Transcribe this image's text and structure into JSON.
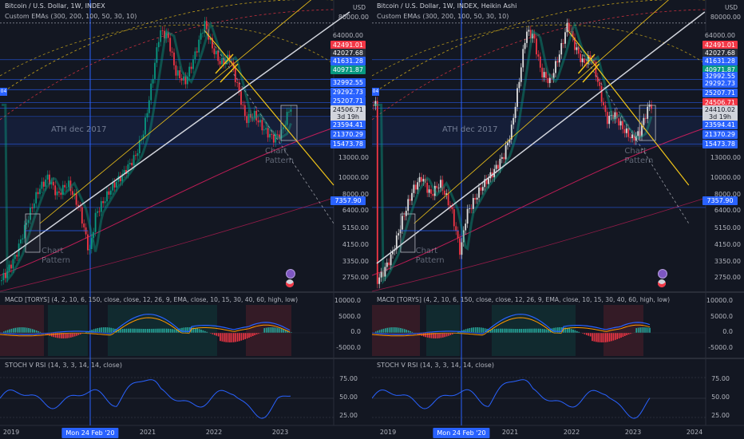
{
  "window": {
    "width": 932,
    "height": 550
  },
  "currency": "USD",
  "panels": [
    {
      "id": "left",
      "title": "Bitcoin / U.S. Dollar, 1W, INDEX",
      "indicator": "Custom EMAs (300, 200, 100, 50, 30, 10)",
      "macd_label": "MACD [TORYS] (4, 2, 10, 6, 150, close, close, 12, 26, 9, EMA, close, 10, 15, 30, 40, 60, high, low)",
      "stoch_label": "STOCH V RSI (14, 3, 3, 14, 14, close)",
      "price_ticks": [
        "80000.00",
        "13000.00",
        "10000.00",
        "8000.00",
        "6400.00",
        "5150.00",
        "4150.00",
        "3350.00",
        "2750.00"
      ],
      "price_tags": [
        {
          "value": "64000.00",
          "bg": "#131722",
          "fg": "#b2b5be"
        },
        {
          "value": "42491.01",
          "bg": "#f23645",
          "fg": "#ffffff"
        },
        {
          "value": "42027.68",
          "bg": "#2a2e39",
          "fg": "#ffffff"
        },
        {
          "value": "41631.28",
          "bg": "#2962ff",
          "fg": "#ffffff"
        },
        {
          "value": "40971.87",
          "bg": "#089981",
          "fg": "#ffffff"
        },
        {
          "value": "32992.55",
          "bg": "#2962ff",
          "fg": "#ffffff"
        },
        {
          "value": "29292.73",
          "bg": "#2962ff",
          "fg": "#ffffff"
        },
        {
          "value": "25207.71",
          "bg": "#2962ff",
          "fg": "#ffffff"
        },
        {
          "value": "24506.71",
          "bg": "#d1d4dc",
          "fg": "#131722"
        },
        {
          "value": "3d 19h",
          "bg": "#d1d4dc",
          "fg": "#131722"
        },
        {
          "value": "23594.41",
          "bg": "#2962ff",
          "fg": "#ffffff"
        },
        {
          "value": "21370.29",
          "bg": "#2962ff",
          "fg": "#ffffff"
        },
        {
          "value": "15473.78",
          "bg": "#2962ff",
          "fg": "#ffffff"
        },
        {
          "value": "7357.90",
          "bg": "#2962ff",
          "fg": "#ffffff"
        }
      ],
      "macd_ticks": [
        "10000.0",
        "5000.0",
        "0.0",
        "-5000.0"
      ],
      "stoch_ticks": [
        "75.00",
        "50.00",
        "25.00"
      ],
      "x_ticks": [
        {
          "label": "2019",
          "x": 14
        },
        {
          "label": "2021",
          "x": 185
        },
        {
          "label": "2022",
          "x": 268
        },
        {
          "label": "2023",
          "x": 351
        }
      ],
      "x_highlight": "Mon 24 Feb '20",
      "annotations": [
        "ATH dec 2017",
        "Chart Pattern",
        "Chart Pattern"
      ],
      "left_tag": "04"
    },
    {
      "id": "right",
      "title": "Bitcoin / U.S. Dollar, 1W, INDEX, Heikin Ashi",
      "indicator": "Custom EMAs (300, 200, 100, 50, 30, 10)",
      "macd_label": "MACD [TORYS] (4, 2, 10, 6, 150, close, close, 12, 26, 9, EMA, close, 10, 15, 30, 40, 60, high, low)",
      "stoch_label": "STOCH V RSI (14, 3, 3, 14, 14, close)",
      "price_ticks": [
        "80000.00",
        "13000.00",
        "10000.00",
        "8000.00",
        "6400.00",
        "5150.00",
        "4150.00",
        "3350.00",
        "2750.00"
      ],
      "price_tags": [
        {
          "value": "64000.00",
          "bg": "#131722",
          "fg": "#b2b5be"
        },
        {
          "value": "42491.01",
          "bg": "#f23645",
          "fg": "#ffffff"
        },
        {
          "value": "42027.68",
          "bg": "#2a2e39",
          "fg": "#ffffff"
        },
        {
          "value": "41631.28",
          "bg": "#2962ff",
          "fg": "#ffffff"
        },
        {
          "value": "40971.87",
          "bg": "#089981",
          "fg": "#ffffff"
        },
        {
          "value": "32992.55",
          "bg": "#2962ff",
          "fg": "#ffffff"
        },
        {
          "value": "29292.73",
          "bg": "#2962ff",
          "fg": "#ffffff"
        },
        {
          "value": "25207.71",
          "bg": "#2962ff",
          "fg": "#ffffff"
        },
        {
          "value": "24506.71",
          "bg": "#f23645",
          "fg": "#ffffff"
        },
        {
          "value": "24410.02",
          "bg": "#d1d4dc",
          "fg": "#131722"
        },
        {
          "value": "3d 19h",
          "bg": "#d1d4dc",
          "fg": "#131722"
        },
        {
          "value": "23594.41",
          "bg": "#2962ff",
          "fg": "#ffffff"
        },
        {
          "value": "21370.29",
          "bg": "#2962ff",
          "fg": "#ffffff"
        },
        {
          "value": "15473.78",
          "bg": "#2962ff",
          "fg": "#ffffff"
        },
        {
          "value": "7357.90",
          "bg": "#2962ff",
          "fg": "#ffffff"
        }
      ],
      "macd_ticks": [
        "10000.0",
        "5000.0",
        "0.0",
        "-5000.0"
      ],
      "stoch_ticks": [
        "75.00",
        "50.00",
        "25.00"
      ],
      "x_ticks": [
        {
          "label": "2019",
          "x": 20
        },
        {
          "label": "2021",
          "x": 173
        },
        {
          "label": "2022",
          "x": 250
        },
        {
          "label": "2023",
          "x": 327
        },
        {
          "label": "2024",
          "x": 404
        }
      ],
      "x_highlight": "Mon 24 Feb '20",
      "annotations": [
        "ATH dec 2017",
        "Chart Pattern",
        "Chart Pattern"
      ],
      "left_tag": "04"
    }
  ],
  "chart_data": {
    "type": "line",
    "title": "Bitcoin / U.S. Dollar, 1W, INDEX",
    "ylabel": "USD",
    "y_scale": "log",
    "ylim": [
      2750,
      80000
    ],
    "x": [
      "2019",
      "2019.5",
      "2020",
      "2020.2",
      "2020.5",
      "2020.8",
      "2021",
      "2021.3",
      "2021.5",
      "2021.8",
      "2022",
      "2022.3",
      "2022.5",
      "2022.8",
      "2023.1"
    ],
    "series": [
      {
        "name": "",
        "values": [
          3600,
          5200,
          9000,
          4500,
          9300,
          11500,
          30000,
          58000,
          34000,
          64000,
          42000,
          38000,
          20000,
          16500,
          23500
        ]
      }
    ],
    "macd_range": [
      -5000,
      10000
    ],
    "stoch_range": [
      25,
      75
    ],
    "colors": {
      "up": "#089981",
      "down": "#f23645",
      "trend_white": "#d1d4dc",
      "trend_yellow": "#f0c419",
      "accent": "#2962ff"
    }
  }
}
